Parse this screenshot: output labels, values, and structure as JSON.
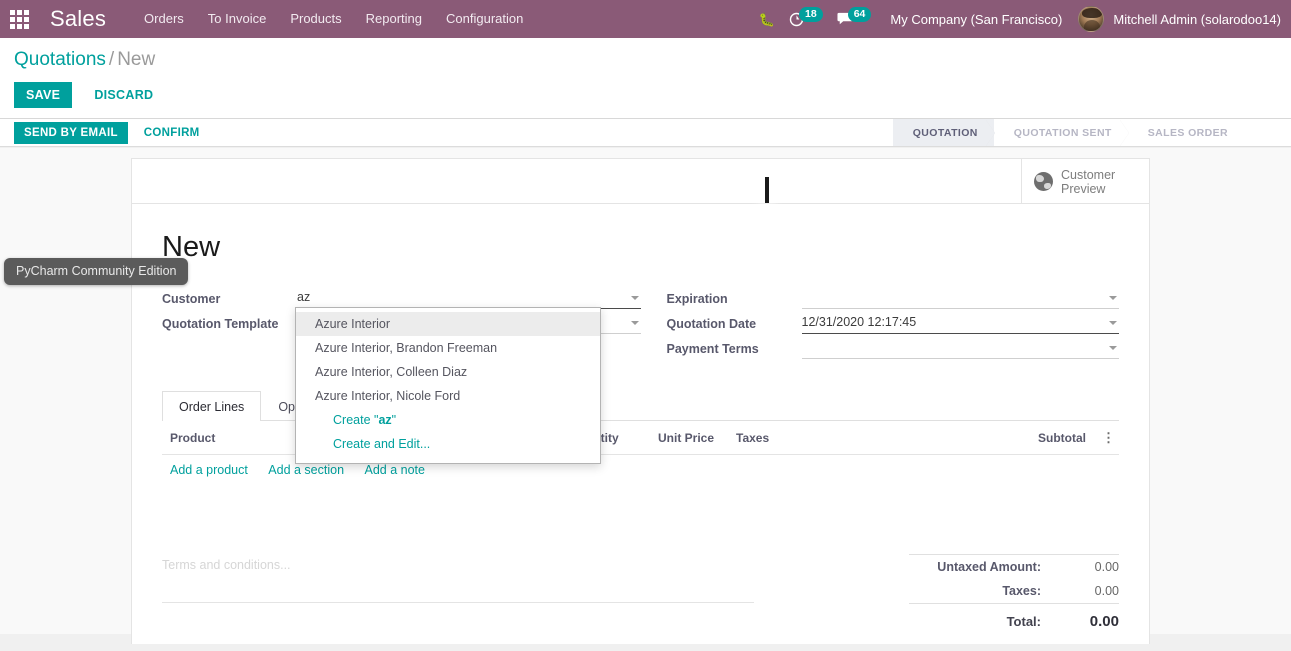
{
  "navbar": {
    "apps_icon": "apps-grid-icon",
    "brand": "Sales",
    "menu": [
      "Orders",
      "To Invoice",
      "Products",
      "Reporting",
      "Configuration"
    ],
    "bug_icon": "bug-icon",
    "activities": {
      "icon": "clock-icon",
      "count": "18"
    },
    "messages": {
      "icon": "chat-icon",
      "count": "64"
    },
    "company": "My Company (San Francisco)",
    "user": "Mitchell Admin (solarodoo14)",
    "avatar": "user-avatar"
  },
  "control_panel": {
    "breadcrumb_root": "Quotations",
    "breadcrumb_sep": "/",
    "breadcrumb_current": "New",
    "save_label": "SAVE",
    "discard_label": "DISCARD"
  },
  "action_bar": {
    "send_by_email": "SEND BY EMAIL",
    "confirm": "CONFIRM",
    "statuses": [
      {
        "label": "QUOTATION",
        "active": true
      },
      {
        "label": "QUOTATION SENT",
        "active": false
      },
      {
        "label": "SALES ORDER",
        "active": false
      }
    ]
  },
  "stat_button": {
    "icon": "globe-icon",
    "line1": "Customer",
    "line2": "Preview"
  },
  "form": {
    "title": "New",
    "left_fields": [
      {
        "label": "Customer",
        "value": "az",
        "placeholder": "",
        "focused": true,
        "dropdown": true
      },
      {
        "label": "Quotation Template",
        "value": "",
        "placeholder": "",
        "focused": false,
        "dropdown": true
      }
    ],
    "right_fields": [
      {
        "label": "Expiration",
        "value": "",
        "placeholder": "",
        "focused": false,
        "dropdown": true
      },
      {
        "label": "Quotation Date",
        "value": "12/31/2020 12:17:45",
        "placeholder": "",
        "focused": true,
        "dropdown": true
      },
      {
        "label": "Payment Terms",
        "value": "",
        "placeholder": "",
        "focused": false,
        "dropdown": true
      }
    ]
  },
  "autocomplete": {
    "options": [
      {
        "label": "Azure Interior",
        "highlighted": true
      },
      {
        "label": "Azure Interior, Brandon Freeman",
        "highlighted": false
      },
      {
        "label": "Azure Interior, Colleen Diaz",
        "highlighted": false
      },
      {
        "label": "Azure Interior, Nicole Ford",
        "highlighted": false
      }
    ],
    "create_prefix": "Create \"",
    "create_term": "az",
    "create_suffix": "\"",
    "create_and_edit": "Create and Edit..."
  },
  "notebook": {
    "tabs": [
      {
        "label": "Order Lines",
        "active": true
      },
      {
        "label": "Optional Products",
        "active": false
      }
    ],
    "columns": [
      "Product",
      "Quantity",
      "Unit Price",
      "Taxes",
      "Subtotal"
    ],
    "options_icon": "vertical-dots-icon",
    "rows": [],
    "add_links": [
      "Add a product",
      "Add a section",
      "Add a note"
    ]
  },
  "bottom": {
    "terms_placeholder": "Terms and conditions...",
    "totals": [
      {
        "label": "Untaxed Amount:",
        "value": "0.00"
      },
      {
        "label": "Taxes:",
        "value": "0.00"
      }
    ],
    "grand_total": {
      "label": "Total:",
      "value": "0.00"
    }
  },
  "os_tooltip": "PyCharm Community Edition",
  "colors": {
    "navbar_bg": "#8a5a77",
    "accent": "#00a09d",
    "badge": "#00a09d",
    "status_active_bg": "#eceef2",
    "sheet_bg": "#ffffff",
    "page_bg": "#f9f9f9"
  }
}
